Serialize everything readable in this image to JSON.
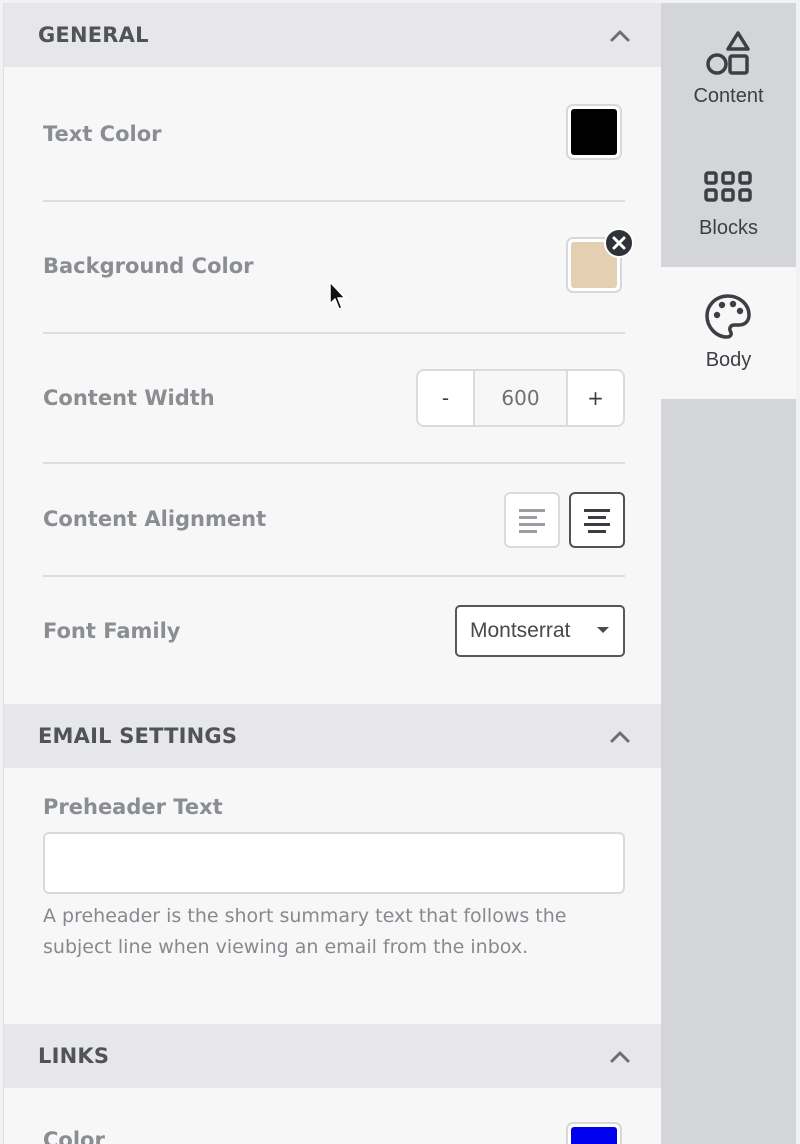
{
  "general": {
    "title": "GENERAL",
    "text_color_label": "Text Color",
    "text_color_value": "#000000",
    "background_color_label": "Background Color",
    "background_color_value": "#e4cfb3",
    "content_width_label": "Content Width",
    "content_width_value": "600",
    "decrement_label": "-",
    "increment_label": "+",
    "content_alignment_label": "Content Alignment",
    "content_alignment_selected": "center",
    "font_family_label": "Font Family",
    "font_family_value": "Montserrat"
  },
  "email_settings": {
    "title": "EMAIL SETTINGS",
    "preheader_label": "Preheader Text",
    "preheader_value": "",
    "preheader_help": "A preheader is the short summary text that follows the subject line when viewing an email from the inbox."
  },
  "links": {
    "title": "LINKS",
    "color_label": "Color",
    "color_value": "#0000ee"
  },
  "rail": {
    "tabs": [
      {
        "label": "Content",
        "icon": "shapes-icon",
        "active": false
      },
      {
        "label": "Blocks",
        "icon": "grid-icon",
        "active": false
      },
      {
        "label": "Body",
        "icon": "palette-icon",
        "active": true
      }
    ]
  },
  "icons": {
    "collapse": "chevron-up-icon",
    "clear": "close-circle-icon",
    "align_left": "align-left-icon",
    "align_center": "align-center-icon",
    "dropdown": "caret-down-icon",
    "pointer": "mouse-pointer-icon"
  }
}
